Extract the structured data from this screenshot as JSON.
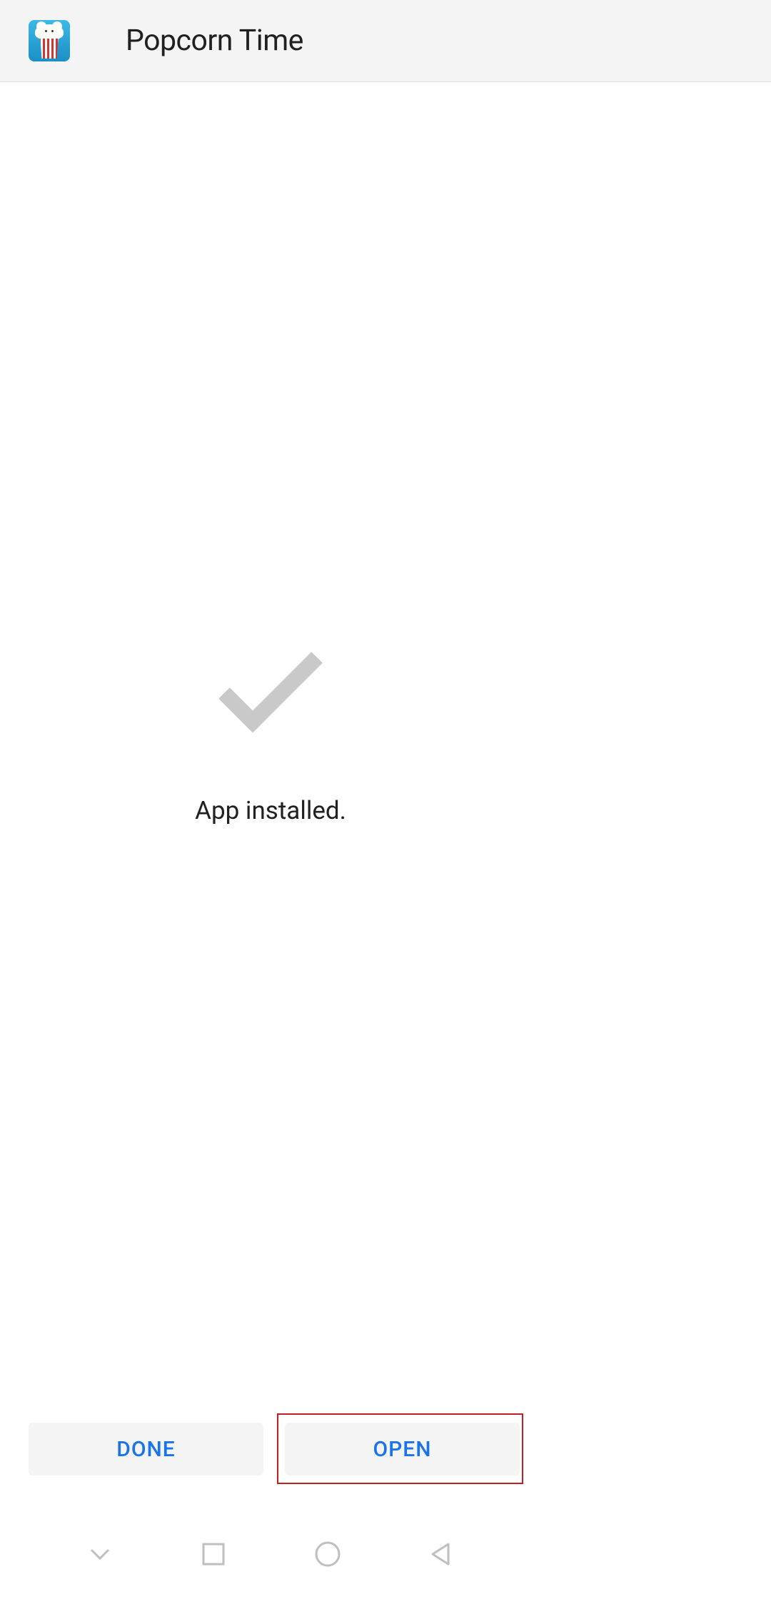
{
  "header": {
    "app_name": "Popcorn Time",
    "icon_name": "popcorn-time-icon"
  },
  "content": {
    "status_message": "App installed.",
    "success_icon": "checkmark-icon"
  },
  "actions": {
    "done_label": "DONE",
    "open_label": "OPEN"
  },
  "colors": {
    "button_text": "#1a73e8",
    "header_bg": "#f4f4f4",
    "highlight_border": "#c02020"
  },
  "nav": {
    "dropdown_icon": "chevron-down-icon",
    "recent_icon": "square-icon",
    "home_icon": "circle-icon",
    "back_icon": "triangle-left-icon"
  }
}
